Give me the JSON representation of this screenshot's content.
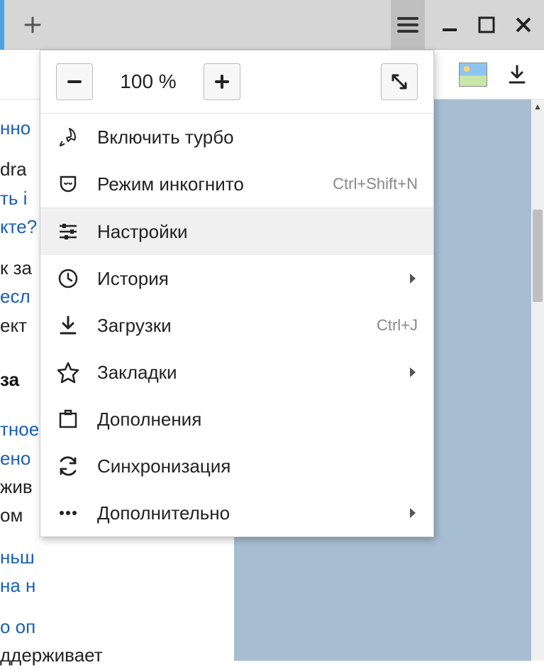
{
  "zoom": {
    "level": "100 %"
  },
  "menu": {
    "turbo": {
      "label": "Включить турбо"
    },
    "incognito": {
      "label": "Режим инкогнито",
      "shortcut": "Ctrl+Shift+N"
    },
    "settings": {
      "label": "Настройки"
    },
    "history": {
      "label": "История"
    },
    "downloads": {
      "label": "Загрузки",
      "shortcut": "Ctrl+J"
    },
    "bookmarks": {
      "label": "Закладки"
    },
    "addons": {
      "label": "Дополнения"
    },
    "sync": {
      "label": "Синхронизация"
    },
    "more": {
      "label": "Дополнительно"
    }
  },
  "page_fragments": {
    "line1": "нно",
    "line2a": "dra ",
    "line2b": "ть і",
    "line2c": "кте?",
    "line3a": "к за",
    "line3b": " есл",
    "line3c": "ект",
    "boldline": "за",
    "line5a": "тное",
    "line5b": "ено",
    "line5c": "жив",
    "line5d": "ом",
    "line6a": "ньш",
    "line6b": "на н",
    "line7a": "о оп",
    "line7b": "ддерживает"
  }
}
